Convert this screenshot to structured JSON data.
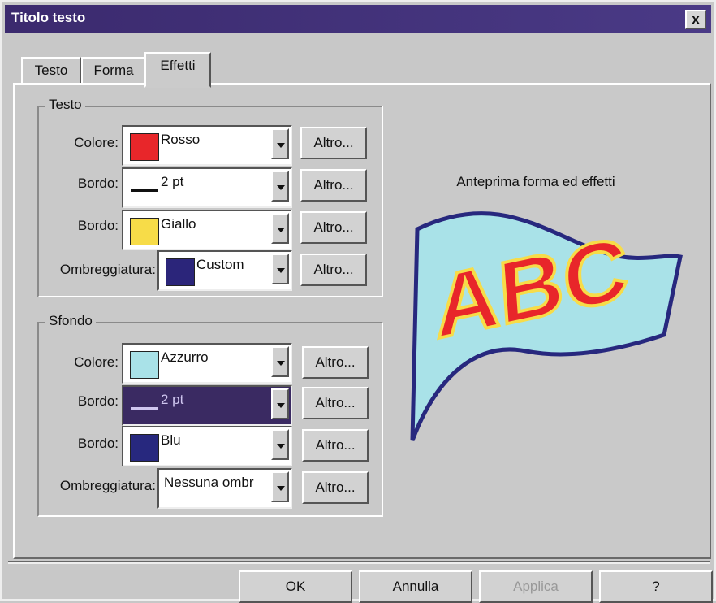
{
  "window": {
    "title": "Titolo testo",
    "close_label": "x"
  },
  "tabs": [
    {
      "label": "Testo"
    },
    {
      "label": "Forma"
    },
    {
      "label": "Effetti"
    }
  ],
  "groups": {
    "testo": {
      "legend": "Testo",
      "rows": [
        {
          "label": "Colore:",
          "value": "Rosso",
          "swatch": "#e8262a"
        },
        {
          "label": "Bordo:",
          "value": "2 pt"
        },
        {
          "label": "Bordo:",
          "value": "Giallo",
          "swatch": "#f7dc48"
        },
        {
          "label": "Ombreggiatura:",
          "value": "Custom",
          "swatch": "#2b257a"
        }
      ]
    },
    "sfondo": {
      "legend": "Sfondo",
      "rows": [
        {
          "label": "Colore:",
          "value": "Azzurro",
          "swatch": "#a9e2e8"
        },
        {
          "label": "Bordo:",
          "value": "2 pt"
        },
        {
          "label": "Bordo:",
          "value": "Blu",
          "swatch": "#27287e"
        },
        {
          "label": "Ombreggiatura:",
          "value": "Nessuna ombr"
        }
      ]
    }
  },
  "altro_label": "Altro...",
  "preview": {
    "label": "Anteprima forma ed effetti",
    "text": "ABC",
    "fill_color": "#a9e2e8",
    "border_color": "#27287e",
    "text_color": "#e8262a",
    "text_border_color": "#f7dc48"
  },
  "buttons": {
    "ok": "OK",
    "annulla": "Annulla",
    "applica": "Applica",
    "help": "?"
  }
}
